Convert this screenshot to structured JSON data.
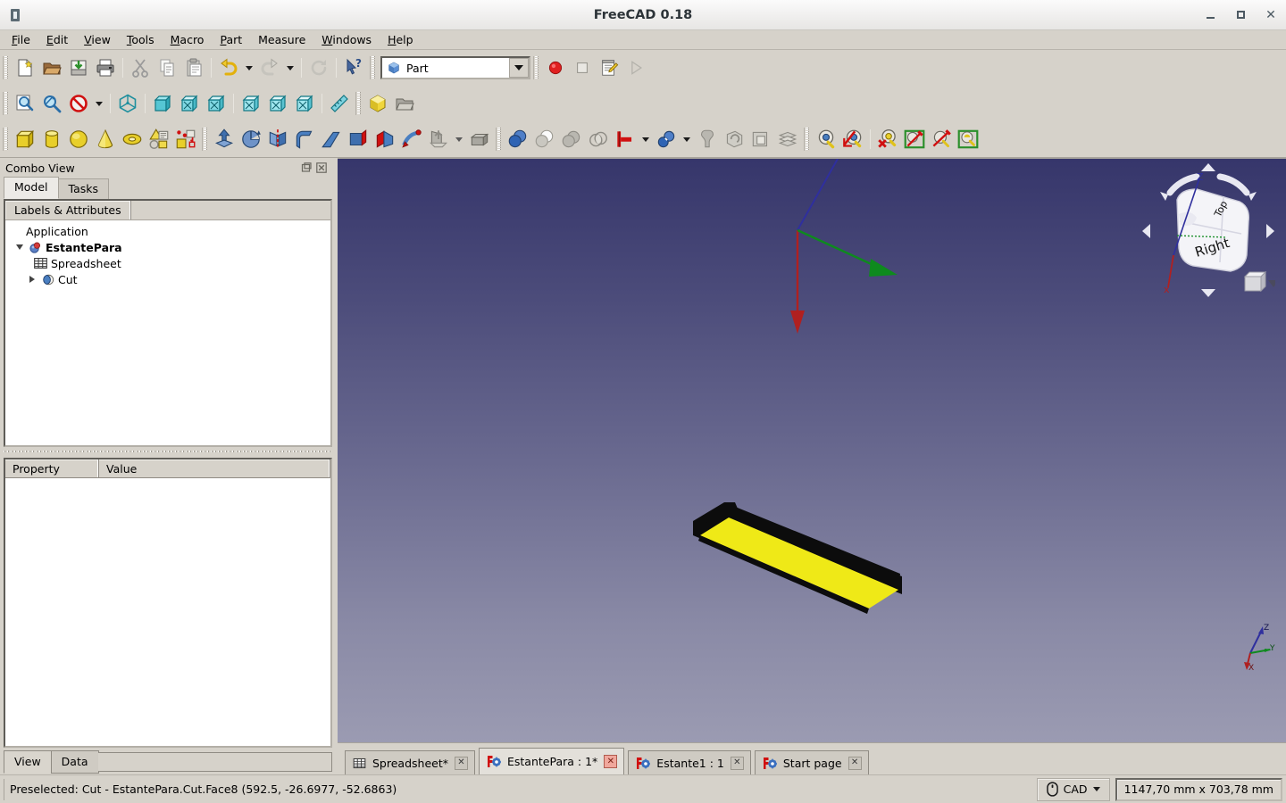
{
  "window": {
    "title": "FreeCAD 0.18",
    "app_icon": "freecad-app-icon",
    "controls": {
      "minimize": "minimize-icon",
      "maximize": "maximize-icon",
      "close": "close-icon"
    }
  },
  "menubar": {
    "items": [
      {
        "label": "File",
        "mnemonic": "F"
      },
      {
        "label": "Edit",
        "mnemonic": "E"
      },
      {
        "label": "View",
        "mnemonic": "V"
      },
      {
        "label": "Tools",
        "mnemonic": "T"
      },
      {
        "label": "Macro",
        "mnemonic": "M"
      },
      {
        "label": "Part",
        "mnemonic": "P"
      },
      {
        "label": "Measure",
        "mnemonic": ""
      },
      {
        "label": "Windows",
        "mnemonic": "W"
      },
      {
        "label": "Help",
        "mnemonic": "H"
      }
    ]
  },
  "toolbars": {
    "file": [
      "new-document-icon",
      "open-document-icon",
      "save-document-icon",
      "print-icon",
      "cut-icon",
      "copy-icon",
      "paste-icon",
      "undo-icon",
      "undo-dropdown-icon",
      "redo-icon",
      "redo-dropdown-icon",
      "refresh-icon",
      "whats-this-icon"
    ],
    "view": [
      "fit-all-icon",
      "fit-selection-icon",
      "draw-style-icon",
      "draw-style-dropdown-icon",
      "axonometric-view-icon",
      "front-view-icon",
      "top-view-icon",
      "right-view-icon",
      "rear-view-icon",
      "bottom-view-icon",
      "left-view-icon",
      "measure-icon"
    ],
    "structure": [
      "create-part-icon",
      "create-group-icon"
    ],
    "part_primitives": [
      "box-icon",
      "cylinder-icon",
      "sphere-icon",
      "cone-icon",
      "torus-icon",
      "create-primitives-icon",
      "shape-builder-icon"
    ],
    "part_tools": [
      "extrude-icon",
      "revolve-icon",
      "mirror-icon",
      "fillet-icon",
      "chamfer-icon",
      "ruled-surface-icon",
      "loft-icon",
      "sweep-icon",
      "section-icon",
      "cross-sections-icon",
      "offset-3d-icon",
      "offset-dropdown-icon",
      "thickness-icon"
    ],
    "boolean": [
      "compound-icon",
      "cut-icon-bool",
      "union-icon",
      "intersection-icon",
      "boolean-icon",
      "boolean-dropdown-icon",
      "join-connect-icon",
      "join-dropdown-icon",
      "split-icon",
      "refine-shape-icon",
      "check-geometry-icon",
      "defeaturing-icon"
    ],
    "selection_view": [
      "select-visible-icon",
      "hide-selection-icon",
      "deselect-icon",
      "box-element-selection-icon",
      "box-selection-icon",
      "appearance-icon"
    ],
    "workbench": {
      "label": "Part",
      "icon": "workbench-part-icon",
      "dropdown": "chevron-down-icon"
    },
    "macro": [
      "macro-record-icon",
      "macro-stop-icon",
      "macro-edit-icon",
      "macro-execute-icon"
    ]
  },
  "combo_view": {
    "title": "Combo View",
    "float_button": "float-panel-icon",
    "close_button": "close-panel-icon",
    "tabs": [
      {
        "label": "Model",
        "active": true
      },
      {
        "label": "Tasks",
        "active": false
      }
    ],
    "tree_header": "Labels & Attributes",
    "tree": [
      {
        "label": "Application",
        "indent": 0,
        "twisty": "none",
        "icon": "none",
        "bold": false
      },
      {
        "label": "EstantePara",
        "indent": 1,
        "twisty": "down",
        "icon": "document-icon",
        "bold": true
      },
      {
        "label": "Spreadsheet",
        "indent": 2,
        "twisty": "none",
        "icon": "spreadsheet-icon",
        "bold": false
      },
      {
        "label": "Cut",
        "indent": 2,
        "twisty": "right",
        "icon": "cut-feature-icon",
        "bold": false
      }
    ],
    "property_editor": {
      "columns": [
        "Property",
        "Value"
      ],
      "rows": []
    },
    "bottom_tabs": [
      {
        "label": "View",
        "active": true
      },
      {
        "label": "Data",
        "active": false
      }
    ]
  },
  "view3d": {
    "nav_cube": {
      "face_label": "Right",
      "top_face_label": "Top",
      "axis_z_label": "Z",
      "axis_x_label": "x",
      "arrows": [
        "rotate-left-arc",
        "rotate-right-arc",
        "arrow-up",
        "arrow-down",
        "arrow-left",
        "arrow-right"
      ],
      "corner_box": "home-view-box-icon",
      "corner_menu": "chevron-down-icon"
    },
    "mini_axis": {
      "x": "X",
      "y": "Y",
      "z": "Z"
    },
    "origin_axes": {
      "x_color": "#bb2222",
      "y_color": "#119922",
      "z_color": "#2222bb"
    },
    "model": {
      "name": "Cut",
      "highlight_face_color": "#efe917",
      "body_color": "#0b0b0b"
    }
  },
  "document_tabs": [
    {
      "label": "Spreadsheet*",
      "icon": "spreadsheet-icon",
      "active": false,
      "close": "close-tab-icon"
    },
    {
      "label": "EstantePara : 1*",
      "icon": "freecad-doc-icon",
      "active": true,
      "close": "close-tab-icon"
    },
    {
      "label": "Estante1 : 1",
      "icon": "freecad-doc-icon",
      "active": false,
      "close": "close-tab-icon"
    },
    {
      "label": "Start page",
      "icon": "freecad-doc-icon",
      "active": false,
      "close": "close-tab-icon"
    }
  ],
  "statusbar": {
    "message": "Preselected: Cut - EstantePara.Cut.Face8 (592.5, -26.6977, -52.6863)",
    "nav_style": {
      "icon": "mouse-icon",
      "label": "CAD",
      "dropdown": "chevron-down-icon"
    },
    "dimensions": "1147,70 mm x 703,78 mm"
  },
  "colors": {
    "chrome": "#d6d2ca",
    "view_top": "#36366b",
    "view_bottom": "#9b9bb2",
    "highlight_yellow": "#efe917",
    "accent_blue": "#3465a4"
  }
}
